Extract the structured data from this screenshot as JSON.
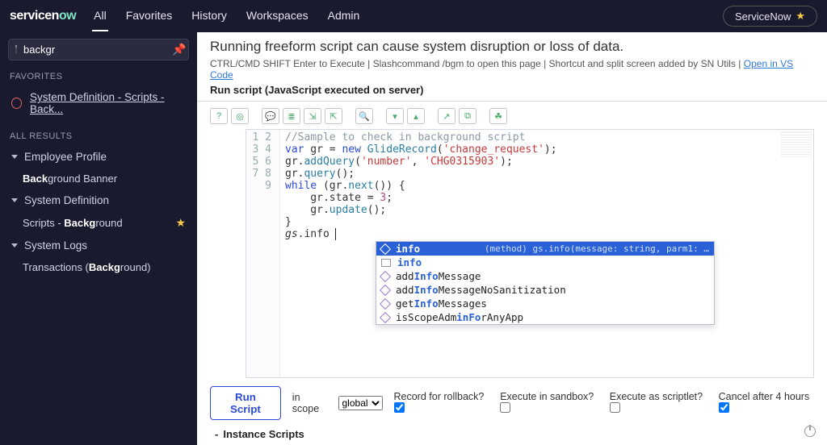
{
  "topbar": {
    "logo_prefix": "servicen",
    "logo_suffix": "ow",
    "tabs": [
      "All",
      "Favorites",
      "History",
      "Workspaces",
      "Admin"
    ],
    "sn_button": "ServiceNow"
  },
  "sidebar": {
    "filter_value": "backgr",
    "fav_header": "FAVORITES",
    "fav_item": "System Definition - Scripts - Back...",
    "all_header": "ALL RESULTS",
    "groups": [
      {
        "label": "Employee Profile",
        "items": [
          {
            "label_pre": "Back",
            "label_mid": "ground Banner",
            "starred": false
          }
        ]
      },
      {
        "label": "System Definition",
        "items": [
          {
            "label_pre": "Scripts - ",
            "label_mid": "Backg",
            "label_post": "round",
            "starred": true
          }
        ]
      },
      {
        "label": "System Logs",
        "items": [
          {
            "label_pre": "Transactions (",
            "label_mid": "Backg",
            "label_post": "round)",
            "starred": false
          }
        ]
      }
    ]
  },
  "banner": "Running freeform script can cause system disruption or loss of data.",
  "subline": {
    "text": "CTRL/CMD SHIFT Enter to Execute | Slashcommand /bgm to open this page | Shortcut and split screen added by SN Utils | ",
    "link": "Open in VS Code"
  },
  "subhead": "Run script (JavaScript executed on server)",
  "toolbar_icons": [
    "help-icon",
    "target-icon",
    "comment-icon",
    "list-icon",
    "step-in-icon",
    "step-out-icon",
    "search-icon",
    "chevron-down-icon",
    "chevron-up-icon",
    "popout-1-icon",
    "popout-2-icon",
    "bug-icon"
  ],
  "code": {
    "lines": [
      1,
      2,
      3,
      4,
      5,
      6,
      7,
      8,
      9
    ]
  },
  "autocomplete": {
    "hint": "(method) gs.info(message: string, parm1: …",
    "items": [
      {
        "kind": "cube",
        "pre": "",
        "hl": "info",
        "post": "",
        "selected": true
      },
      {
        "kind": "letter",
        "pre": "",
        "hl": "info",
        "post": ""
      },
      {
        "kind": "cube",
        "pre": "add",
        "hl": "Info",
        "post": "Message"
      },
      {
        "kind": "cube",
        "pre": "add",
        "hl": "Info",
        "post": "MessageNoSanitization"
      },
      {
        "kind": "cube",
        "pre": "get",
        "hl": "Info",
        "post": "Messages"
      },
      {
        "kind": "cube",
        "pre": "isScopeAdm",
        "hl": "inFo",
        "post": "rAnyApp"
      }
    ]
  },
  "footer": {
    "run": "Run Script",
    "scope_label": "in scope",
    "scope_value": "global",
    "rollback": "Record for rollback?",
    "sandbox": "Execute in sandbox?",
    "scriptlet": "Execute as scriptlet?",
    "cancel": "Cancel after 4 hours"
  },
  "collapse": "Instance Scripts"
}
